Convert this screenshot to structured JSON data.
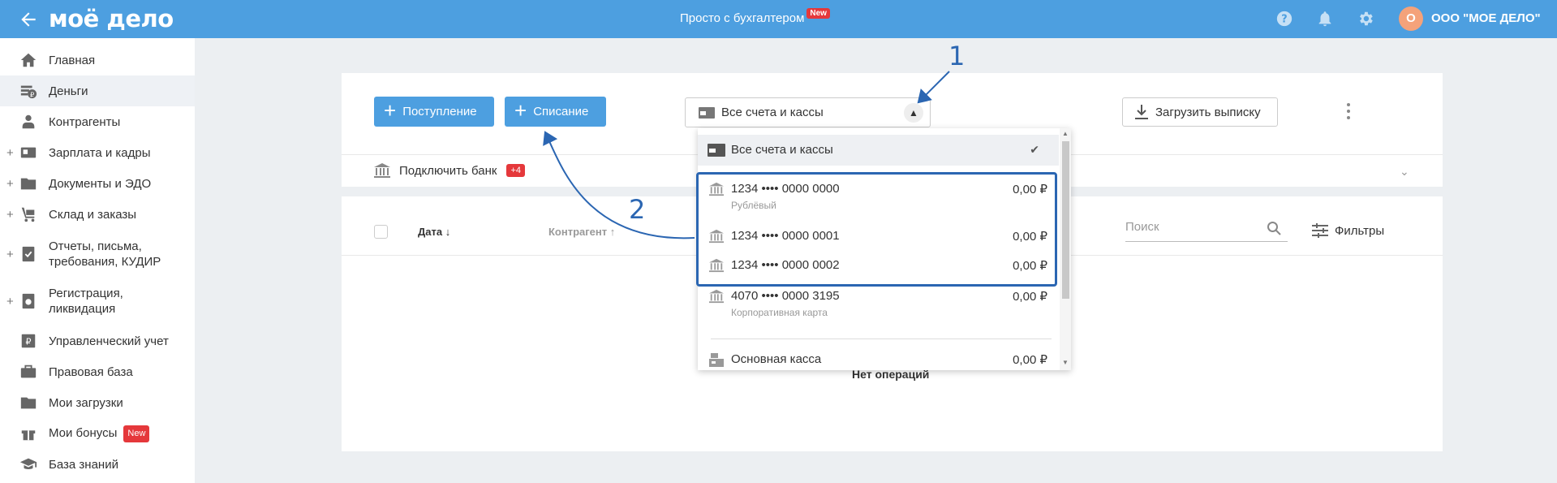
{
  "header": {
    "logo": "моё дело",
    "center_link": "Просто с бухгалтером",
    "center_badge": "New",
    "avatar_letter": "О",
    "org_name": "ООО \"МОЕ ДЕЛО\""
  },
  "sidebar": {
    "items": [
      {
        "label": "Главная"
      },
      {
        "label": "Деньги"
      },
      {
        "label": "Контрагенты"
      },
      {
        "label": "Зарплата и кадры"
      },
      {
        "label": "Документы и ЭДО"
      },
      {
        "label": "Склад и заказы"
      },
      {
        "label": "Отчеты, письма, требования, КУДИР"
      },
      {
        "label": "Регистрация, ликвидация"
      },
      {
        "label": "Управленческий учет"
      },
      {
        "label": "Правовая база"
      },
      {
        "label": "Мои загрузки"
      },
      {
        "label": "Мои бонусы",
        "badge": "New"
      },
      {
        "label": "База знаний"
      }
    ]
  },
  "toolbar": {
    "income_label": "Поступление",
    "expense_label": "Списание",
    "account_select": "Все счета и кассы",
    "upload_label": "Загрузить выписку",
    "connect_bank": "Подключить банк",
    "connect_badge": "+4"
  },
  "table": {
    "col_date": "Дата ↓",
    "col_contractor": "Контрагент ↑",
    "search_placeholder": "Поиск",
    "filters": "Фильтры",
    "empty": "Нет операций"
  },
  "dropdown": {
    "all": "Все счета и кассы",
    "accounts": [
      {
        "name": "1234 •••• 0000 0000",
        "sub": "Рублёвый",
        "amount": "0,00 ₽"
      },
      {
        "name": "1234 •••• 0000 0001",
        "sub": "",
        "amount": "0,00 ₽"
      },
      {
        "name": "1234 •••• 0000 0002",
        "sub": "",
        "amount": "0,00 ₽"
      },
      {
        "name": "4070 •••• 0000 3195",
        "sub": "Корпоративная карта",
        "amount": "0,00 ₽"
      },
      {
        "name": "Основная касса",
        "sub": "",
        "amount": "0,00 ₽"
      }
    ]
  },
  "annotations": {
    "one": "1",
    "two": "2"
  },
  "colors": {
    "header": "#4d9fe0",
    "annotation": "#2b66b2",
    "badge": "#e5383b"
  }
}
